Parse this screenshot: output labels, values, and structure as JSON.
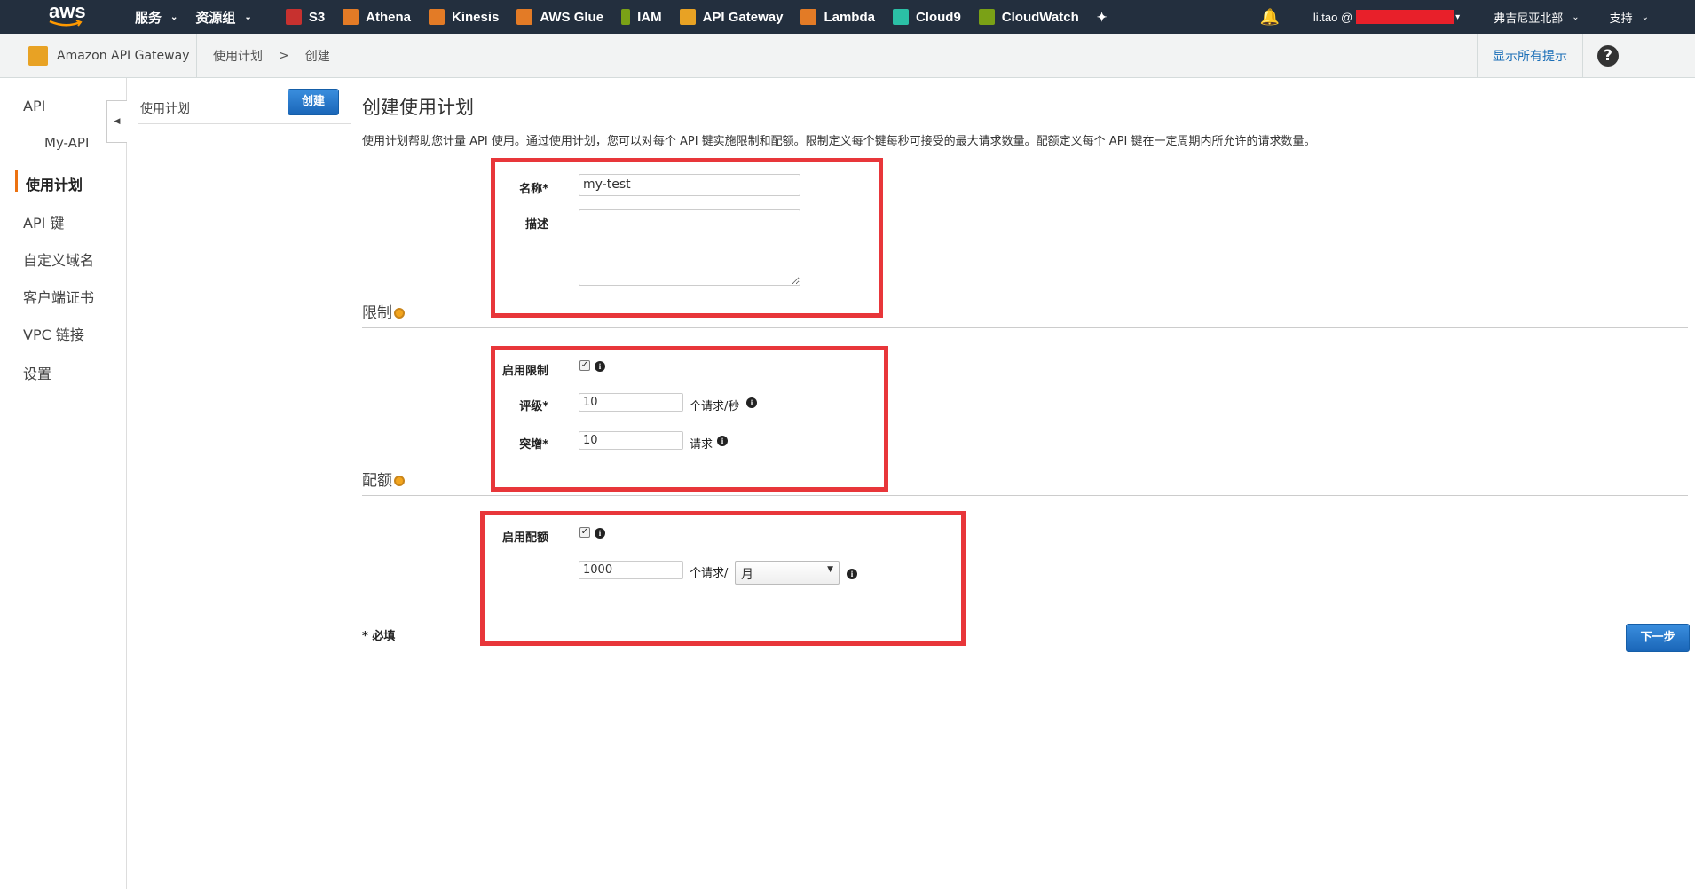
{
  "topnav": {
    "logo": "aws",
    "services": "服务",
    "resource_groups": "资源组",
    "shortcuts": [
      {
        "label": "S3",
        "icon": "s3-icon",
        "color": "#c7312f"
      },
      {
        "label": "Athena",
        "icon": "athena-icon",
        "color": "#e37b26"
      },
      {
        "label": "Kinesis",
        "icon": "kinesis-icon",
        "color": "#e37b26"
      },
      {
        "label": "AWS Glue",
        "icon": "glue-icon",
        "color": "#e37b26"
      },
      {
        "label": "IAM",
        "icon": "iam-icon",
        "color": "#7aa116"
      },
      {
        "label": "API Gateway",
        "icon": "api-gateway-icon",
        "color": "#e8a224"
      },
      {
        "label": "Lambda",
        "icon": "lambda-icon",
        "color": "#e37b26"
      },
      {
        "label": "Cloud9",
        "icon": "cloud9-icon",
        "color": "#2bc0a6"
      },
      {
        "label": "CloudWatch",
        "icon": "cloudwatch-icon",
        "color": "#7aa116"
      }
    ],
    "user": "li.tao @",
    "region": "弗吉尼亚北部",
    "support": "支持"
  },
  "subnav": {
    "service": "Amazon API Gateway",
    "crumb_1": "使用计划",
    "sep": ">",
    "crumb_2": "创建",
    "tips": "显示所有提示",
    "help": "?"
  },
  "leftnav": {
    "api": "API",
    "my_api": "My-API",
    "usage_plans": "使用计划",
    "api_keys": "API 键",
    "custom_domains": "自定义域名",
    "client_certs": "客户端证书",
    "vpc_links": "VPC 链接",
    "settings": "设置"
  },
  "col2": {
    "title": "使用计划",
    "create": "创建"
  },
  "main": {
    "title": "创建使用计划",
    "description": "使用计划帮助您计量 API 使用。通过使用计划，您可以对每个 API 键实施限制和配额。限制定义每个键每秒可接受的最大请求数量。配额定义每个 API 键在一定周期内所允许的请求数量。",
    "name_label": "名称*",
    "name_value": "my-test",
    "desc_label": "描述",
    "throttle_title": "限制",
    "enable_throttle": "启用限制",
    "rate_label": "评级*",
    "rate_value": "10",
    "rate_unit": "个请求/秒",
    "burst_label": "突增*",
    "burst_value": "10",
    "burst_unit": "请求",
    "quota_title": "配额",
    "enable_quota": "启用配额",
    "quota_value": "1000",
    "quota_unit": "个请求/",
    "quota_period": "月",
    "required": "* 必填",
    "next": "下一步"
  },
  "colors": {
    "nav_bg": "#232f3e",
    "highlight_red": "#e8363a",
    "primary_blue": "#1f73c9",
    "active_orange": "#ec7211"
  }
}
